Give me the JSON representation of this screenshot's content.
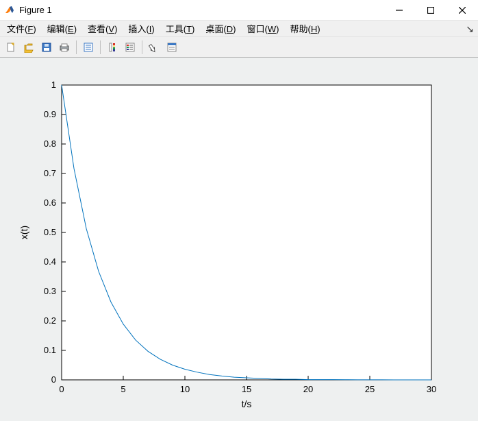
{
  "window": {
    "title": "Figure 1"
  },
  "menu": {
    "items": [
      {
        "label": "文件",
        "accel": "F"
      },
      {
        "label": "编辑",
        "accel": "E"
      },
      {
        "label": "查看",
        "accel": "V"
      },
      {
        "label": "插入",
        "accel": "I"
      },
      {
        "label": "工具",
        "accel": "T"
      },
      {
        "label": "桌面",
        "accel": "D"
      },
      {
        "label": "窗口",
        "accel": "W"
      },
      {
        "label": "帮助",
        "accel": "H"
      }
    ]
  },
  "toolbar": {
    "buttons": [
      {
        "name": "new-figure",
        "icon": "new"
      },
      {
        "name": "open",
        "icon": "open"
      },
      {
        "name": "save",
        "icon": "save"
      },
      {
        "name": "print",
        "icon": "print"
      },
      {
        "name": "sep"
      },
      {
        "name": "link",
        "icon": "link"
      },
      {
        "name": "sep"
      },
      {
        "name": "colorbar",
        "icon": "colorbar"
      },
      {
        "name": "legend",
        "icon": "legend"
      },
      {
        "name": "sep"
      },
      {
        "name": "edit-plot",
        "icon": "arrow"
      },
      {
        "name": "property-editor",
        "icon": "props"
      }
    ]
  },
  "axes": {
    "xlabel": "t/s",
    "ylabel": "x(t)",
    "xticks": [
      0,
      5,
      10,
      15,
      20,
      25,
      30
    ],
    "yticks": [
      0,
      0.1,
      0.2,
      0.3,
      0.4,
      0.5,
      0.6,
      0.7,
      0.8,
      0.9,
      1
    ],
    "xlim": [
      0,
      30
    ],
    "ylim": [
      0,
      1
    ],
    "line_color": "#0072bd"
  },
  "chart_data": {
    "type": "line",
    "title": "",
    "xlabel": "t/s",
    "ylabel": "x(t)",
    "xlim": [
      0,
      30
    ],
    "ylim": [
      0,
      1
    ],
    "series": [
      {
        "name": "x(t)",
        "x": [
          0,
          1,
          2,
          3,
          4,
          5,
          6,
          7,
          8,
          9,
          10,
          11,
          12,
          13,
          14,
          15,
          16,
          17,
          18,
          19,
          20,
          21,
          22,
          23,
          24,
          25,
          26,
          27,
          28,
          29,
          30
        ],
        "y": [
          1,
          0.717,
          0.513,
          0.368,
          0.264,
          0.189,
          0.135,
          0.097,
          0.07,
          0.05,
          0.036,
          0.026,
          0.018,
          0.013,
          0.009,
          0.007,
          0.005,
          0.003,
          0.002,
          0.002,
          0.001,
          0.001,
          0.001,
          0.0005,
          0.0003,
          0.0002,
          0.0002,
          0.0001,
          0.0001,
          0.0001,
          0
        ]
      }
    ]
  }
}
